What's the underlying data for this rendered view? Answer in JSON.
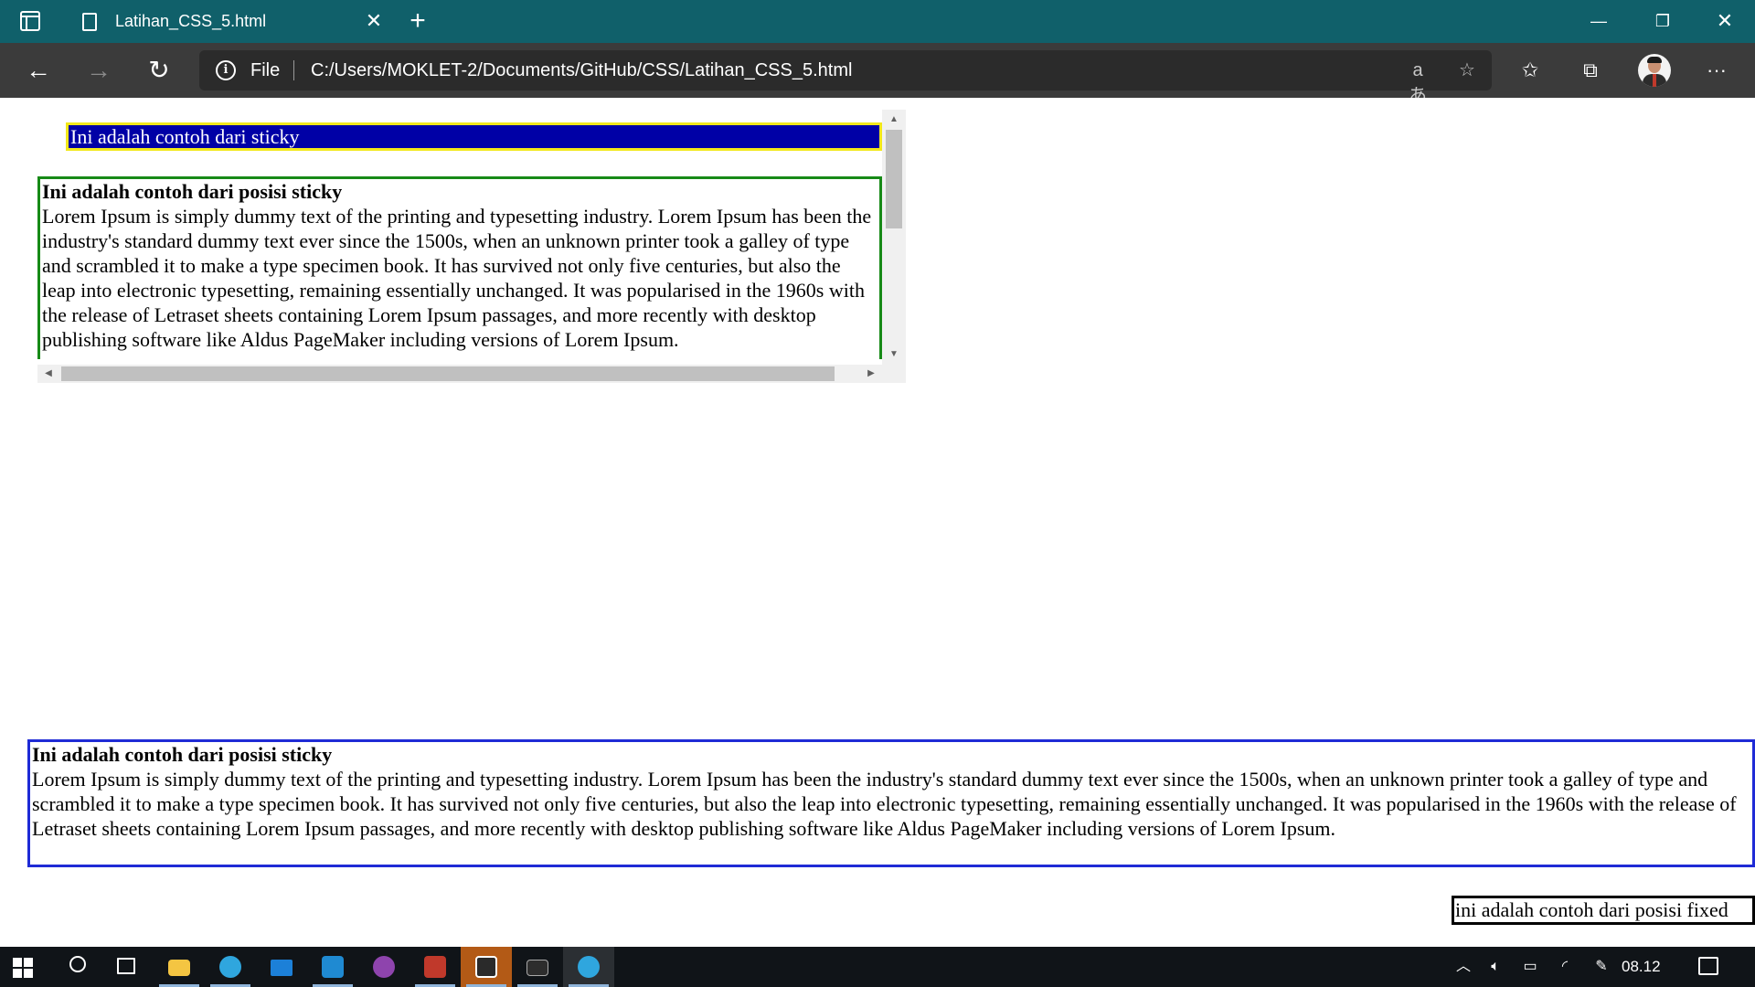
{
  "browser": {
    "tab_title": "Latihan_CSS_5.html",
    "tab_close": "✕",
    "new_tab": "+",
    "window_min": "—",
    "window_max": "❐",
    "window_close": "✕",
    "address_scheme_label": "File",
    "url": "C:/Users/MOKLET-2/Documents/GitHub/CSS/Latihan_CSS_5.html",
    "icons": {
      "back": "←",
      "forward": "→",
      "refresh": "↻",
      "read_aloud": "aあ",
      "add_favorite": "☆",
      "favorites": "✩",
      "collections": "⧉",
      "more": "···"
    }
  },
  "page": {
    "sticky_label": "Ini adalah contoh dari sticky",
    "inner_box": {
      "heading": "Ini adalah contoh dari posisi sticky",
      "body": "Lorem Ipsum is simply dummy text of the printing and typesetting industry. Lorem Ipsum has been the industry's standard dummy text ever since the 1500s, when an unknown printer took a galley of type and scrambled it to make a type specimen book. It has survived not only five centuries, but also the leap into electronic typesetting, remaining essentially unchanged. It was popularised in the 1960s with the release of Letraset sheets containing Lorem Ipsum passages, and more recently with desktop publishing software like Aldus PageMaker including versions of Lorem Ipsum."
    },
    "outer_box": {
      "heading": "Ini adalah contoh dari posisi sticky",
      "body": "Lorem Ipsum is simply dummy text of the printing and typesetting industry. Lorem Ipsum has been the industry's standard dummy text ever since the 1500s, when an unknown printer took a galley of type and scrambled it to make a type specimen book. It has survived not only five centuries, but also the leap into electronic typesetting, remaining essentially unchanged. It was popularised in the 1960s with the release of Letraset sheets containing Lorem Ipsum passages, and more recently with desktop publishing software like Aldus PageMaker including versions of Lorem Ipsum."
    },
    "fixed_label": "ini adalah contoh dari posisi fixed",
    "colors": {
      "sticky_bg": "#0000a6",
      "sticky_border": "#f2e81a",
      "inner_border": "#178a17",
      "outer_border": "#1f2bd6",
      "fixed_border": "#000000"
    }
  },
  "taskbar": {
    "clock": "08.12",
    "apps": [
      "windows-start",
      "search",
      "task-view",
      "file-explorer",
      "edge",
      "mail",
      "vscode",
      "github-desktop",
      "app-red",
      "app-orange",
      "terminal",
      "edge-active"
    ],
    "tray_icons": [
      "chevron-up-icon",
      "volume-icon",
      "battery-icon",
      "wifi-icon",
      "pen-icon"
    ]
  }
}
